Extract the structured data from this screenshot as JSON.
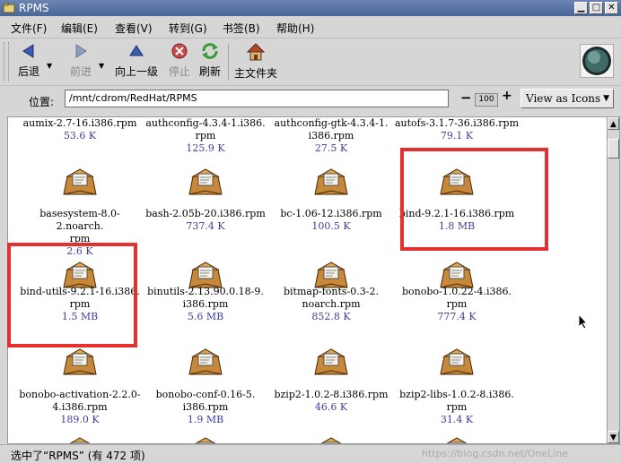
{
  "window": {
    "title": "RPMS"
  },
  "menu": [
    "文件(F)",
    "编辑(E)",
    "查看(V)",
    "转到(G)",
    "书签(B)",
    "帮助(H)"
  ],
  "toolbar": {
    "back": "后退",
    "forward": "前进",
    "up": "向上一级",
    "stop": "停止",
    "refresh": "刷新",
    "home": "主文件夹"
  },
  "location": {
    "label": "位置:",
    "path": "/mnt/cdrom/RedHat/RPMS"
  },
  "zoom": {
    "minus": "−",
    "value": "100",
    "plus": "+"
  },
  "view_mode": "View as Icons",
  "files": {
    "r0": [
      {
        "name1": "aumix-2.7-16.i386.rpm",
        "name2": "",
        "size": "53.6  K"
      },
      {
        "name1": "authconfig-4.3.4-1.i386.",
        "name2": "rpm",
        "size": "125.9  K"
      },
      {
        "name1": "authconfig-gtk-4.3.4-1.",
        "name2": "i386.rpm",
        "size": "27.5  K"
      },
      {
        "name1": "autofs-3.1.7-36.i386.rpm",
        "name2": "",
        "size": "79.1  K"
      }
    ],
    "r1": [
      {
        "name1": "basesystem-8.0-2.noarch.",
        "name2": "rpm",
        "size": "2.6  K"
      },
      {
        "name1": "bash-2.05b-20.i386.rpm",
        "name2": "",
        "size": "737.4  K"
      },
      {
        "name1": "bc-1.06-12.i386.rpm",
        "name2": "",
        "size": "100.5  K"
      },
      {
        "name1": "bind-9.2.1-16.i386.rpm",
        "name2": "",
        "size": "1.8  MB"
      }
    ],
    "r2": [
      {
        "name1": "bind-utils-9.2.1-16.i386.",
        "name2": "rpm",
        "size": "1.5  MB"
      },
      {
        "name1": "binutils-2.13.90.0.18-9.",
        "name2": "i386.rpm",
        "size": "5.6  MB"
      },
      {
        "name1": "bitmap-fonts-0.3-2.",
        "name2": "noarch.rpm",
        "size": "852.8  K"
      },
      {
        "name1": "bonobo-1.0.22-4.i386.",
        "name2": "rpm",
        "size": "777.4  K"
      }
    ],
    "r3": [
      {
        "name1": "bonobo-activation-2.2.0-",
        "name2": "4.i386.rpm",
        "size": "189.0  K"
      },
      {
        "name1": "bonobo-conf-0.16-5.",
        "name2": "i386.rpm",
        "size": "1.9  MB"
      },
      {
        "name1": "bzip2-1.0.2-8.i386.rpm",
        "name2": "",
        "size": "46.6  K"
      },
      {
        "name1": "bzip2-libs-1.0.2-8.i386.",
        "name2": "rpm",
        "size": "31.4  K"
      }
    ]
  },
  "status": "选中了“RPMS” (有 472 项)",
  "watermark": "https://blog.csdn.net/OneLine"
}
